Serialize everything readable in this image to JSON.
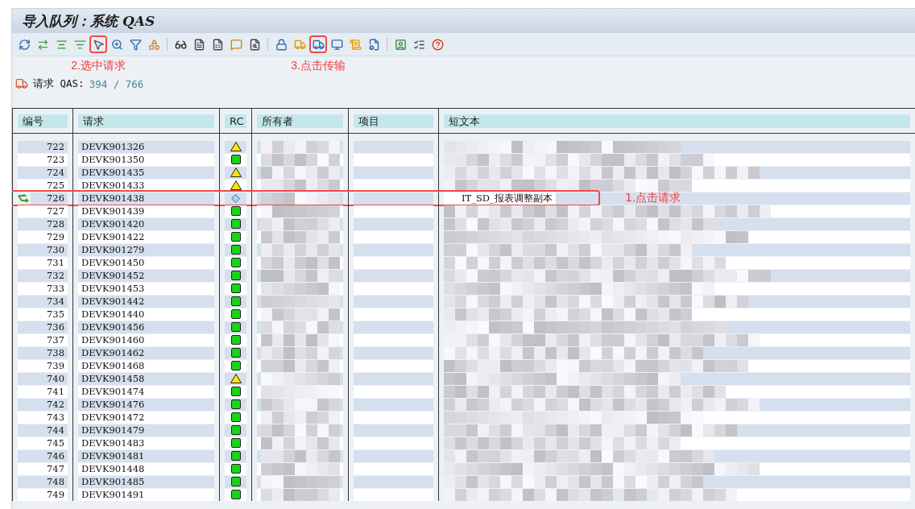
{
  "window": {
    "title": "导入队列：系统 QAS"
  },
  "toolbar_buttons": [
    {
      "highlighted": false
    },
    {
      "highlighted": false
    },
    {
      "highlighted": false
    },
    {
      "highlighted": false
    },
    {
      "highlighted": true,
      "callout": "2.选中请求"
    },
    {
      "highlighted": false
    },
    {
      "highlighted": false
    },
    {
      "highlighted": false
    },
    {
      "highlighted": false
    },
    {
      "highlighted": false
    },
    {
      "highlighted": false
    },
    {
      "highlighted": false
    },
    {
      "highlighted": false
    },
    {
      "highlighted": false
    },
    {
      "highlighted": false
    },
    {
      "highlighted": true,
      "callout": "3.点击传输"
    },
    {
      "highlighted": false
    },
    {
      "highlighted": false
    },
    {
      "highlighted": false
    },
    {
      "highlighted": false
    },
    {
      "highlighted": false
    },
    {
      "highlighted": false
    }
  ],
  "status_line": {
    "label": "请求 QAS:",
    "count": "394 / 766"
  },
  "table": {
    "columns": [
      "编号",
      "请求",
      "RC",
      "所有者",
      "项目",
      "短文本"
    ],
    "rows": [
      {
        "number": "722",
        "request": "DEVK901326",
        "kind": "warning",
        "selected": false,
        "redacted": true
      },
      {
        "number": "723",
        "request": "DEVK901350",
        "kind": "ok",
        "selected": false,
        "redacted": true
      },
      {
        "number": "724",
        "request": "DEVK901435",
        "kind": "warning",
        "selected": false,
        "redacted": true
      },
      {
        "number": "725",
        "request": "DEVK901433",
        "kind": "warning",
        "selected": false,
        "redacted": true
      },
      {
        "number": "726",
        "request": "DEVK901438",
        "kind": "pending",
        "selected": true,
        "redacted": true,
        "short_text": "IT_SD_报表调整副本",
        "callout": "1.点击请求"
      },
      {
        "number": "727",
        "request": "DEVK901439",
        "kind": "ok",
        "selected": false,
        "redacted": true
      },
      {
        "number": "728",
        "request": "DEVK901420",
        "kind": "ok",
        "selected": false,
        "redacted": true
      },
      {
        "number": "729",
        "request": "DEVK901422",
        "kind": "ok",
        "selected": false,
        "redacted": true
      },
      {
        "number": "730",
        "request": "DEVK901279",
        "kind": "ok",
        "selected": false,
        "redacted": true
      },
      {
        "number": "731",
        "request": "DEVK901450",
        "kind": "ok",
        "selected": false,
        "redacted": true
      },
      {
        "number": "732",
        "request": "DEVK901452",
        "kind": "ok",
        "selected": false,
        "redacted": true
      },
      {
        "number": "733",
        "request": "DEVK901453",
        "kind": "ok",
        "selected": false,
        "redacted": true
      },
      {
        "number": "734",
        "request": "DEVK901442",
        "kind": "ok",
        "selected": false,
        "redacted": true
      },
      {
        "number": "735",
        "request": "DEVK901440",
        "kind": "ok",
        "selected": false,
        "redacted": true
      },
      {
        "number": "736",
        "request": "DEVK901456",
        "kind": "ok",
        "selected": false,
        "redacted": true
      },
      {
        "number": "737",
        "request": "DEVK901460",
        "kind": "ok",
        "selected": false,
        "redacted": true
      },
      {
        "number": "738",
        "request": "DEVK901462",
        "kind": "ok",
        "selected": false,
        "redacted": true
      },
      {
        "number": "739",
        "request": "DEVK901468",
        "kind": "ok",
        "selected": false,
        "redacted": true
      },
      {
        "number": "740",
        "request": "DEVK901458",
        "kind": "warning",
        "selected": false,
        "redacted": true
      },
      {
        "number": "741",
        "request": "DEVK901474",
        "kind": "ok",
        "selected": false,
        "redacted": true
      },
      {
        "number": "742",
        "request": "DEVK901476",
        "kind": "ok",
        "selected": false,
        "redacted": true
      },
      {
        "number": "743",
        "request": "DEVK901472",
        "kind": "ok",
        "selected": false,
        "redacted": true
      },
      {
        "number": "744",
        "request": "DEVK901479",
        "kind": "ok",
        "selected": false,
        "redacted": true
      },
      {
        "number": "745",
        "request": "DEVK901483",
        "kind": "ok",
        "selected": false,
        "redacted": true
      },
      {
        "number": "746",
        "request": "DEVK901481",
        "kind": "ok",
        "selected": false,
        "redacted": true
      },
      {
        "number": "747",
        "request": "DEVK901448",
        "kind": "ok",
        "selected": false,
        "redacted": true
      },
      {
        "number": "748",
        "request": "DEVK901485",
        "kind": "ok",
        "selected": false,
        "redacted": true
      },
      {
        "number": "749",
        "request": "DEVK901491",
        "kind": "ok",
        "selected": false,
        "redacted": true
      }
    ]
  }
}
